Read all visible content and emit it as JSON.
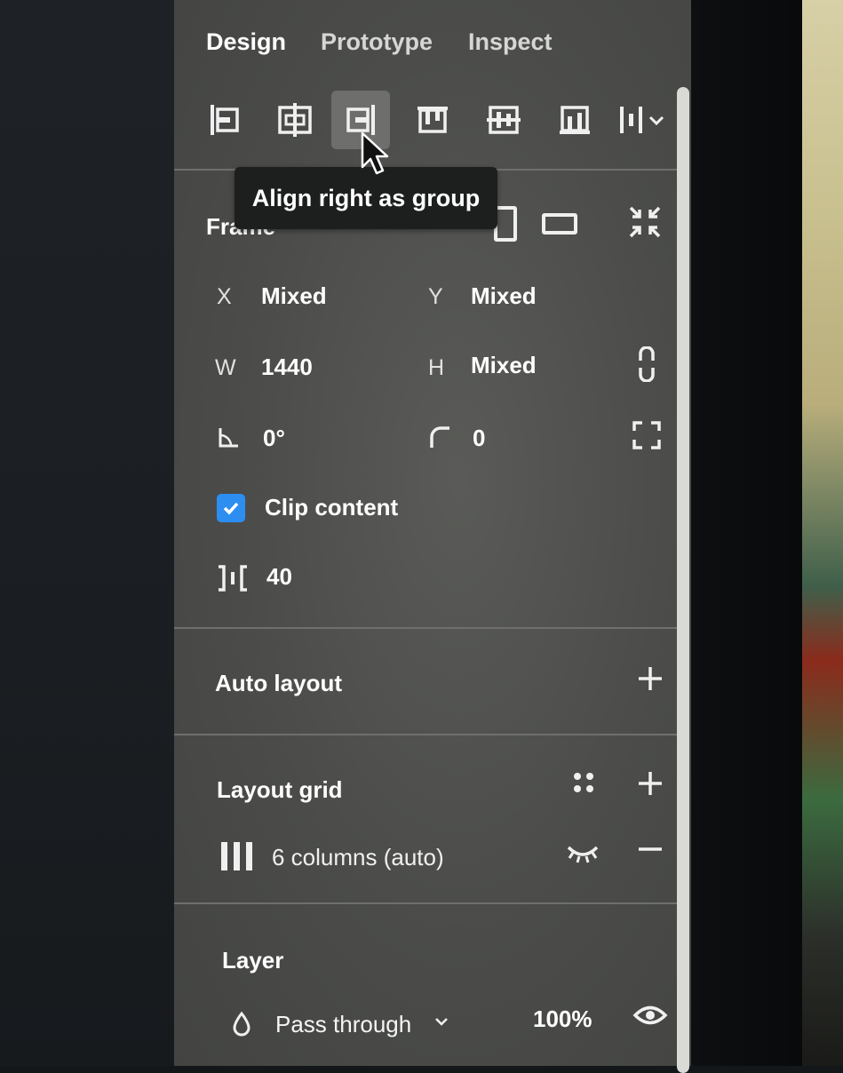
{
  "tabs": [
    {
      "label": "Design",
      "active": true
    },
    {
      "label": "Prototype",
      "active": false
    },
    {
      "label": "Inspect",
      "active": false
    }
  ],
  "align_toolbar": {
    "buttons": [
      {
        "icon": "align-left-icon"
      },
      {
        "icon": "align-horizontal-center-icon"
      },
      {
        "icon": "align-right-icon",
        "hovered": true
      },
      {
        "icon": "align-top-icon"
      },
      {
        "icon": "align-vertical-center-icon"
      },
      {
        "icon": "align-bottom-icon"
      },
      {
        "icon": "distribute-dropdown-icon"
      }
    ],
    "tooltip": "Align right as group"
  },
  "frame": {
    "title": "Frame",
    "x_label": "X",
    "x_value": "Mixed",
    "y_label": "Y",
    "y_value": "Mixed",
    "w_label": "W",
    "w_value": "1440",
    "h_label": "H",
    "h_value": "Mixed",
    "rotation_value": "0°",
    "radius_value": "0",
    "clip_content_label": "Clip content",
    "clip_content_checked": true,
    "spacing_value": "40"
  },
  "auto_layout": {
    "title": "Auto layout"
  },
  "layout_grid": {
    "title": "Layout grid",
    "grid_label": "6 columns (auto)"
  },
  "layer": {
    "title": "Layer",
    "blend_mode": "Pass through",
    "opacity": "100%"
  },
  "colors": {
    "panel_bg": "#4b4c4a",
    "accent": "#2d8ef2",
    "tooltip_bg": "#1d1e1e"
  }
}
